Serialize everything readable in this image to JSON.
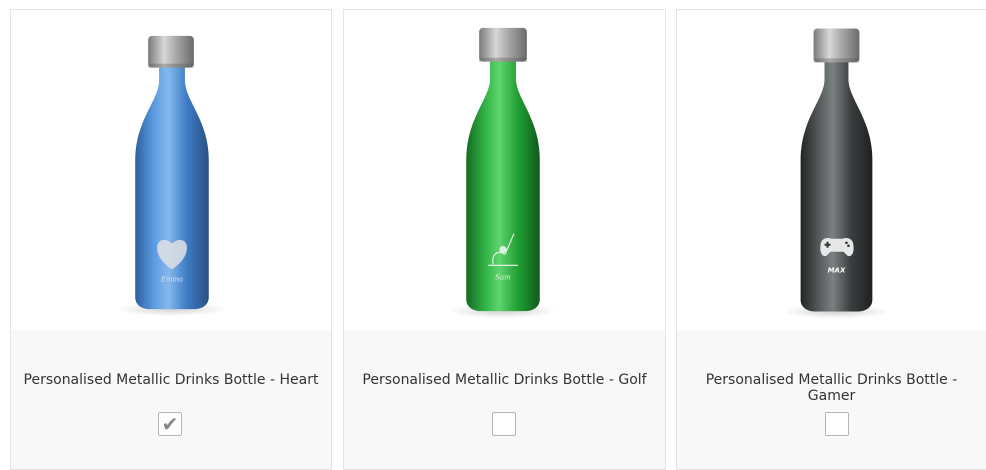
{
  "products": [
    {
      "title": "Personalised Metallic Drinks Bottle - Heart",
      "selected": true,
      "bottle_color": "#3f7cc6",
      "engraving": "Emma"
    },
    {
      "title": "Personalised Metallic Drinks Bottle - Golf",
      "selected": false,
      "bottle_color": "#22a23a",
      "engraving": "Sam"
    },
    {
      "title": "Personalised Metallic Drinks Bottle - Gamer",
      "selected": false,
      "bottle_color": "#3a3d3d",
      "engraving": "MAX"
    }
  ],
  "checkmark_glyph": "✔"
}
